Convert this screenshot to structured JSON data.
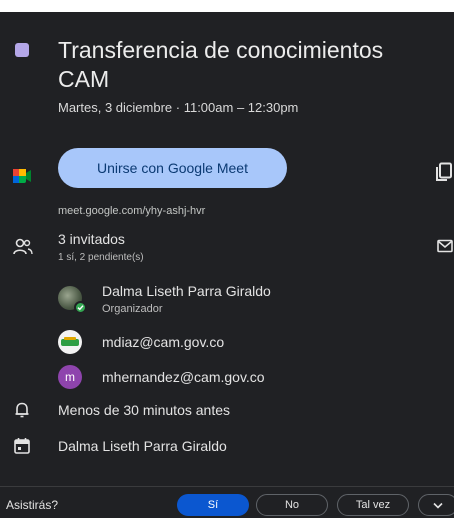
{
  "event": {
    "color": "#b4a7e8",
    "title": "Transferencia de conocimientos CAM",
    "datetime": "Martes, 3 diciembre  ·  11:00am – 12:30pm"
  },
  "meet": {
    "join_label": "Unirse con Google Meet",
    "link": "meet.google.com/yhy-ashj-hvr",
    "button_color": "#a8c7fa"
  },
  "guests": {
    "count_label": "3 invitados",
    "detail": "1 sí, 2 pendiente(s)",
    "list": [
      {
        "name": "Dalma Liseth Parra Giraldo",
        "role": "Organizador",
        "avatar": "photo-avatar"
      },
      {
        "name": "mdiaz@cam.gov.co",
        "avatar": "logo-avatar"
      },
      {
        "name": "mhernandez@cam.gov.co",
        "avatar_letter": "m",
        "avatar_color": "#8e44ad"
      }
    ]
  },
  "reminder": "Menos de 30 minutos antes",
  "calendar_owner": "Dalma Liseth Parra Giraldo",
  "rsvp": {
    "question": "Asistirás?",
    "yes": "Sí",
    "no": "No",
    "maybe": "Tal vez",
    "more_icon": "chevron-down-icon",
    "accent": "#0b57d0"
  },
  "icons": [
    "meet-icon",
    "copy-icon",
    "people-icon",
    "mail-icon",
    "bell-icon",
    "calendar-icon",
    "check-icon"
  ]
}
